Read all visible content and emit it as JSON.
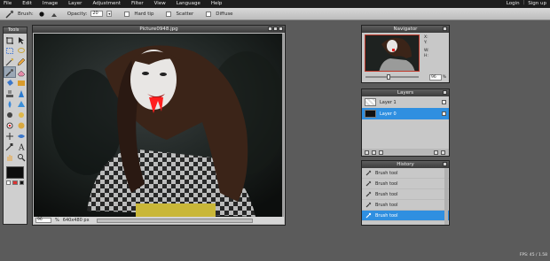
{
  "menu": {
    "items": [
      "File",
      "Edit",
      "Image",
      "Layer",
      "Adjustment",
      "Filter",
      "View",
      "Language",
      "Help"
    ],
    "login": "Login",
    "separator": "|",
    "signup": "Sign up"
  },
  "options": {
    "brush_label": "Brush:",
    "opacity_label": "Opacity:",
    "opacity_value": "20",
    "hard_tip": "Hard tip",
    "scatter": "Scatter",
    "diffuse": "Diffuse"
  },
  "tools": {
    "title": "Tools",
    "items": [
      "crop-icon",
      "move-icon",
      "marquee-icon",
      "lasso-icon",
      "wand-icon",
      "pencil-icon",
      "brush-icon",
      "eraser-icon",
      "bucket-icon",
      "gradient-icon",
      "stamp-icon",
      "sharpen-icon",
      "smudge-icon",
      "sponge-icon",
      "burn-icon",
      "dodge-icon",
      "redeye-icon",
      "bloat-icon",
      "pinch-icon",
      "sponge2-icon",
      "dropper-icon",
      "type-icon",
      "hand-icon",
      "zoom-icon"
    ],
    "active_index": 6,
    "primary_color": "#0d0d0d",
    "secondary_color": "#ffffff"
  },
  "image_window": {
    "title": "Picture0948.jpg",
    "zoom": "96",
    "zoom_unit": "%",
    "dimensions": "640x480 px"
  },
  "navigator": {
    "title": "Navigator",
    "x_label": "X:",
    "y_label": "Y:",
    "w_label": "W:",
    "h_label": "H:",
    "zoom": "96",
    "zoom_unit": "%"
  },
  "layers": {
    "title": "Layers",
    "rows": [
      {
        "name": "Layer 1",
        "selected": false
      },
      {
        "name": "Layer 0",
        "selected": true
      }
    ]
  },
  "history": {
    "title": "History",
    "rows": [
      {
        "label": "Brush tool",
        "selected": false
      },
      {
        "label": "Brush tool",
        "selected": false
      },
      {
        "label": "Brush tool",
        "selected": false
      },
      {
        "label": "Brush tool",
        "selected": false
      },
      {
        "label": "Brush tool",
        "selected": true
      }
    ]
  },
  "footnote": "FPS: 45 / 1.58"
}
